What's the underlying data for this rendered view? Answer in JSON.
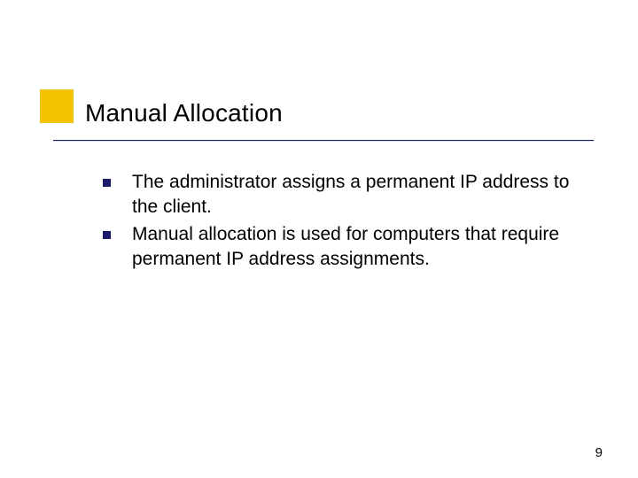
{
  "slide": {
    "title": "Manual Allocation",
    "bullets": [
      "The administrator assigns a permanent IP address to the client.",
      "Manual allocation is used for computers that require permanent IP address assignments."
    ],
    "page_number": "9"
  },
  "colors": {
    "accent_yellow": "#f3c300",
    "rule_navy": "#1a1a6a"
  }
}
